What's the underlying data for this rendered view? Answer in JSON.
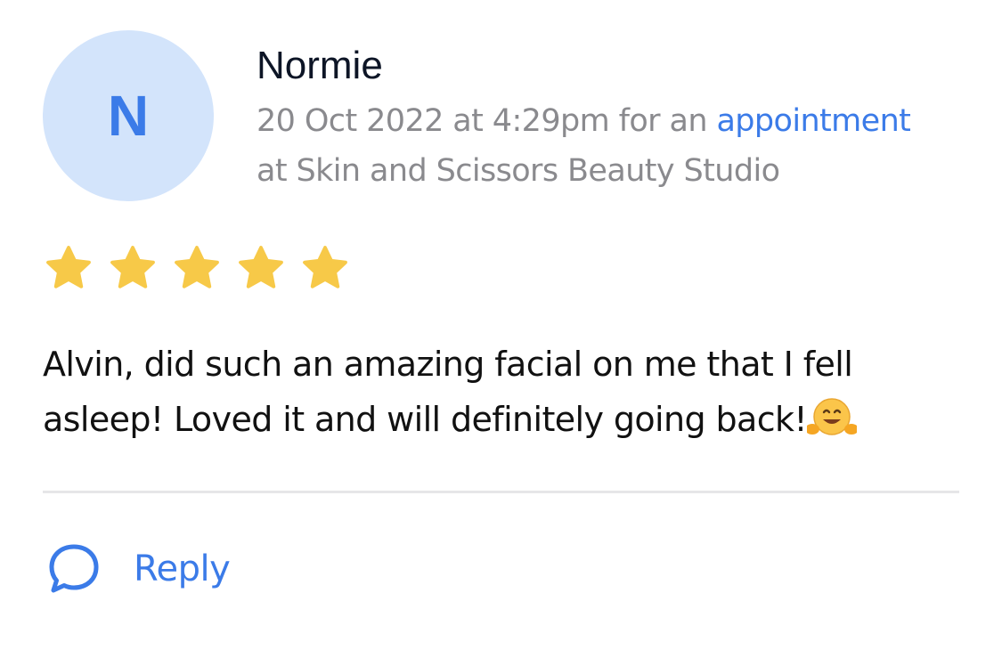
{
  "review": {
    "avatar_initial": "N",
    "reviewer_name": "Normie",
    "meta_prefix": "20 Oct 2022 at 4:29pm for an ",
    "meta_link": "appointment",
    "meta_line2": "at Skin and Scissors Beauty Studio",
    "rating": 5,
    "rating_max": 5,
    "text": "Alvin, did such an amazing facial on me that I fell asleep! Loved it and will definitely going back!",
    "emoji": "hugging-face"
  },
  "actions": {
    "reply_label": "Reply",
    "reply_icon": "speech-bubble-icon"
  },
  "colors": {
    "accent": "#3b7be8",
    "avatar_bg": "#d3e4fb",
    "star": "#f7c948",
    "meta_text": "#8a8a8e",
    "divider": "#e6e6e8"
  }
}
